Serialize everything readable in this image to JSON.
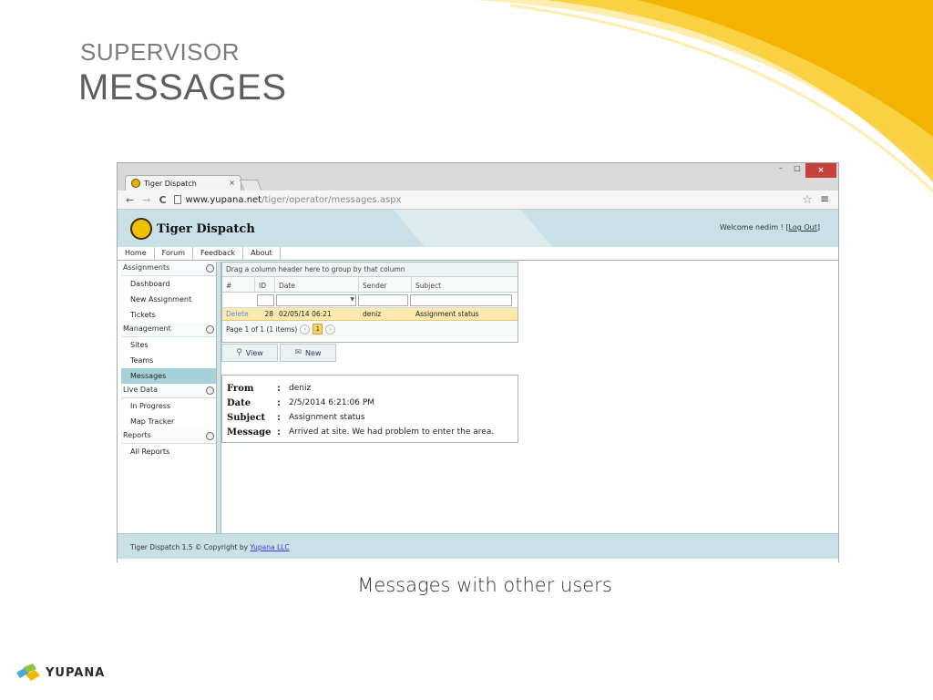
{
  "slide": {
    "subtitle": "SUPERVISOR",
    "title": "MESSAGES",
    "caption": "Messages with other users",
    "logo_text": "YUPANA"
  },
  "browser": {
    "tab_title": "Tiger Dispatch",
    "tab_close": "×",
    "url_host": "www.yupana.net",
    "url_path": "/tiger/operator/messages.aspx",
    "back": "←",
    "forward": "→",
    "reload": "C",
    "star": "☆",
    "menu": "≡",
    "minimize": "–",
    "maximize": "□",
    "close": "×"
  },
  "app": {
    "title": "Tiger Dispatch",
    "welcome_prefix": "Welcome nedim ! [",
    "logout": "Log Out",
    "welcome_suffix": "]",
    "menu": [
      "Home",
      "Forum",
      "Feedback",
      "About"
    ],
    "sidebar": [
      {
        "group": "Assignments",
        "items": [
          "Dashboard",
          "New Assignment",
          "Tickets"
        ]
      },
      {
        "group": "Management",
        "items": [
          "Sites",
          "Teams",
          "Messages"
        ]
      },
      {
        "group": "Live Data",
        "items": [
          "In Progress",
          "Map Tracker"
        ]
      },
      {
        "group": "Reports",
        "items": [
          "All Reports"
        ]
      }
    ],
    "active_item": "Messages",
    "footer_text": "Tiger Dispatch 1.5  © Copyright by ",
    "footer_link": "Yupana LLC"
  },
  "grid": {
    "group_hint": "Drag a column header here to group by that column",
    "columns": [
      "#",
      "ID",
      "Date",
      "Sender",
      "Subject"
    ],
    "rows": [
      {
        "action": "Delete",
        "id": "28",
        "date": "02/05/14 06:21",
        "sender": "deniz",
        "subject": "Assignment status"
      }
    ],
    "pager_text": "Page 1 of 1 (1 items)",
    "prev": "‹",
    "page": "1",
    "next": "›",
    "view_label": "View",
    "new_label": "New"
  },
  "message": {
    "from_label": "From",
    "from": "deniz",
    "date_label": "Date",
    "date": "2/5/2014 6:21:06 PM",
    "subject_label": "Subject",
    "subject": "Assignment status",
    "message_label": "Message",
    "message": "Arrived at site. We had problem to enter the area.",
    "colon": ":"
  },
  "colors": {
    "header_bg": "#c9e0e6",
    "active_item": "#a7d1d9",
    "selected_row": "#fbe9b0",
    "close_button": "#c8403b"
  }
}
